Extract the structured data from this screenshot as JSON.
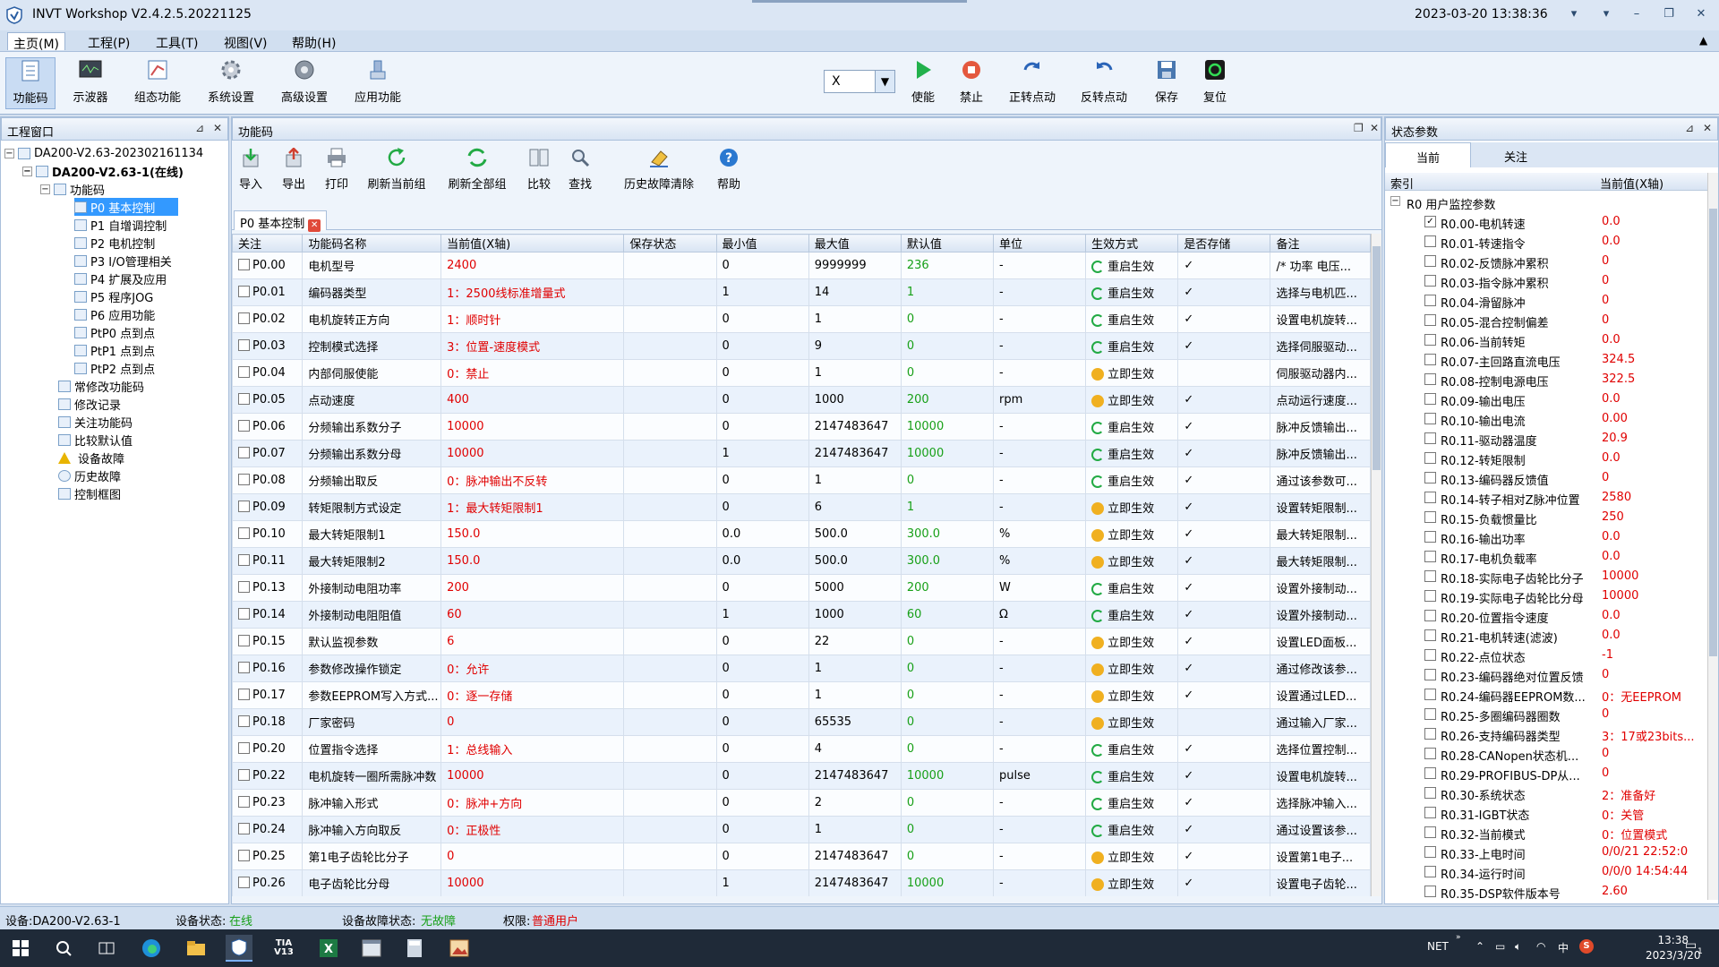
{
  "app": {
    "title": "INVT Workshop V2.4.2.5.20221125",
    "datetime": "2023-03-20 13:38:36"
  },
  "menu": [
    "主页(M)",
    "工程(P)",
    "工具(T)",
    "视图(V)",
    "帮助(H)"
  ],
  "ribbon": {
    "left": [
      "功能码",
      "示波器",
      "组态功能",
      "系统设置",
      "高级设置",
      "应用功能"
    ],
    "axis_value": "X",
    "right": [
      "使能",
      "禁止",
      "正转点动",
      "反转点动",
      "保存",
      "复位"
    ]
  },
  "left_panel": {
    "title": "工程窗口",
    "tree": [
      "DA200-V2.63-202302161134",
      "DA200-V2.63-1(在线)",
      "功能码",
      "P0 基本控制",
      "P1 自增调控制",
      "P2 电机控制",
      "P3 I/O管理相关",
      "P4 扩展及应用",
      "P5 程序JOG",
      "P6 应用功能",
      "PtP0 点到点",
      "PtP1 点到点",
      "PtP2 点到点",
      "常修改功能码",
      "修改记录",
      "关注功能码",
      "比较默认值",
      "设备故障",
      "历史故障",
      "控制框图"
    ]
  },
  "center": {
    "title": "功能码",
    "toolbar": [
      "导入",
      "导出",
      "打印",
      "刷新当前组",
      "刷新全部组",
      "比较",
      "查找",
      "历史故障清除",
      "帮助"
    ],
    "doc_tab": "P0 基本控制",
    "columns": [
      "关注",
      "功能码名称",
      "当前值(X轴)",
      "保存状态",
      "最小值",
      "最大值",
      "默认值",
      "单位",
      "生效方式",
      "是否存储",
      "备注"
    ],
    "rows": [
      [
        "P0.00",
        "电机型号",
        "2400",
        "",
        "0",
        "9999999",
        "236",
        "-",
        "重启生效",
        "✓",
        "/* 功率 电压..."
      ],
      [
        "P0.01",
        "编码器类型",
        "1：2500线标准增量式",
        "",
        "1",
        "14",
        "1",
        "-",
        "重启生效",
        "✓",
        "选择与电机匹..."
      ],
      [
        "P0.02",
        "电机旋转正方向",
        "1：顺时针",
        "",
        "0",
        "1",
        "0",
        "-",
        "重启生效",
        "✓",
        "设置电机旋转..."
      ],
      [
        "P0.03",
        "控制模式选择",
        "3：位置-速度模式",
        "",
        "0",
        "9",
        "0",
        "-",
        "重启生效",
        "✓",
        "选择伺服驱动..."
      ],
      [
        "P0.04",
        "内部伺服使能",
        "0：禁止",
        "",
        "0",
        "1",
        "0",
        "-",
        "立即生效",
        "",
        "伺服驱动器内..."
      ],
      [
        "P0.05",
        "点动速度",
        "400",
        "",
        "0",
        "1000",
        "200",
        "rpm",
        "立即生效",
        "✓",
        "点动运行速度..."
      ],
      [
        "P0.06",
        "分频输出系数分子",
        "10000",
        "",
        "0",
        "2147483647",
        "10000",
        "-",
        "重启生效",
        "✓",
        "脉冲反馈输出..."
      ],
      [
        "P0.07",
        "分频输出系数分母",
        "10000",
        "",
        "1",
        "2147483647",
        "10000",
        "-",
        "重启生效",
        "✓",
        "脉冲反馈输出..."
      ],
      [
        "P0.08",
        "分频输出取反",
        "0：脉冲输出不反转",
        "",
        "0",
        "1",
        "0",
        "-",
        "重启生效",
        "✓",
        "通过该参数可..."
      ],
      [
        "P0.09",
        "转矩限制方式设定",
        "1：最大转矩限制1",
        "",
        "0",
        "6",
        "1",
        "-",
        "立即生效",
        "✓",
        "设置转矩限制..."
      ],
      [
        "P0.10",
        "最大转矩限制1",
        "150.0",
        "",
        "0.0",
        "500.0",
        "300.0",
        "%",
        "立即生效",
        "✓",
        "最大转矩限制..."
      ],
      [
        "P0.11",
        "最大转矩限制2",
        "150.0",
        "",
        "0.0",
        "500.0",
        "300.0",
        "%",
        "立即生效",
        "✓",
        "最大转矩限制..."
      ],
      [
        "P0.13",
        "外接制动电阻功率",
        "200",
        "",
        "0",
        "5000",
        "200",
        "W",
        "重启生效",
        "✓",
        "设置外接制动..."
      ],
      [
        "P0.14",
        "外接制动电阻阻值",
        "60",
        "",
        "1",
        "1000",
        "60",
        "Ω",
        "重启生效",
        "✓",
        "设置外接制动..."
      ],
      [
        "P0.15",
        "默认监视参数",
        "6",
        "",
        "0",
        "22",
        "0",
        "-",
        "立即生效",
        "✓",
        "设置LED面板..."
      ],
      [
        "P0.16",
        "参数修改操作锁定",
        "0：允许",
        "",
        "0",
        "1",
        "0",
        "-",
        "立即生效",
        "✓",
        "通过修改该参..."
      ],
      [
        "P0.17",
        "参数EEPROM写入方式...",
        "0：逐一存储",
        "",
        "0",
        "1",
        "0",
        "-",
        "立即生效",
        "✓",
        "设置通过LED..."
      ],
      [
        "P0.18",
        "厂家密码",
        "0",
        "",
        "0",
        "65535",
        "0",
        "-",
        "立即生效",
        "",
        "通过输入厂家..."
      ],
      [
        "P0.20",
        "位置指令选择",
        "1：总线输入",
        "",
        "0",
        "4",
        "0",
        "-",
        "重启生效",
        "✓",
        "选择位置控制..."
      ],
      [
        "P0.22",
        "电机旋转一圈所需脉冲数",
        "10000",
        "",
        "0",
        "2147483647",
        "10000",
        "pulse",
        "重启生效",
        "✓",
        "设置电机旋转..."
      ],
      [
        "P0.23",
        "脉冲输入形式",
        "0：脉冲+方向",
        "",
        "0",
        "2",
        "0",
        "-",
        "重启生效",
        "✓",
        "选择脉冲输入..."
      ],
      [
        "P0.24",
        "脉冲输入方向取反",
        "0：正极性",
        "",
        "0",
        "1",
        "0",
        "-",
        "重启生效",
        "✓",
        "通过设置该参..."
      ],
      [
        "P0.25",
        "第1电子齿轮比分子",
        "0",
        "",
        "0",
        "2147483647",
        "0",
        "-",
        "立即生效",
        "✓",
        "设置第1电子..."
      ],
      [
        "P0.26",
        "电子齿轮比分母",
        "10000",
        "",
        "1",
        "2147483647",
        "10000",
        "-",
        "立即生效",
        "✓",
        "设置电子齿轮..."
      ]
    ]
  },
  "right_panel": {
    "title": "状态参数",
    "tabs": [
      "当前",
      "关注"
    ],
    "columns": [
      "索引",
      "当前值(X轴)"
    ],
    "group": "R0 用户监控参数",
    "items": [
      [
        "R0.00-电机转速",
        "0.0",
        true
      ],
      [
        "R0.01-转速指令",
        "0.0",
        false
      ],
      [
        "R0.02-反馈脉冲累积",
        "0",
        false
      ],
      [
        "R0.03-指令脉冲累积",
        "0",
        false
      ],
      [
        "R0.04-滑留脉冲",
        "0",
        false
      ],
      [
        "R0.05-混合控制偏差",
        "0",
        false
      ],
      [
        "R0.06-当前转矩",
        "0.0",
        false
      ],
      [
        "R0.07-主回路直流电压",
        "324.5",
        false
      ],
      [
        "R0.08-控制电源电压",
        "322.5",
        false
      ],
      [
        "R0.09-输出电压",
        "0.0",
        false
      ],
      [
        "R0.10-输出电流",
        "0.00",
        false
      ],
      [
        "R0.11-驱动器温度",
        "20.9",
        false
      ],
      [
        "R0.12-转矩限制",
        "0.0",
        false
      ],
      [
        "R0.13-编码器反馈值",
        "0",
        false
      ],
      [
        "R0.14-转子相对Z脉冲位置",
        "2580",
        false
      ],
      [
        "R0.15-负载惯量比",
        "250",
        false
      ],
      [
        "R0.16-输出功率",
        "0.0",
        false
      ],
      [
        "R0.17-电机负载率",
        "0.0",
        false
      ],
      [
        "R0.18-实际电子齿轮比分子",
        "10000",
        false
      ],
      [
        "R0.19-实际电子齿轮比分母",
        "10000",
        false
      ],
      [
        "R0.20-位置指令速度",
        "0.0",
        false
      ],
      [
        "R0.21-电机转速(滤波)",
        "0.0",
        false
      ],
      [
        "R0.22-点位状态",
        "-1",
        false
      ],
      [
        "R0.23-编码器绝对位置反馈",
        "0",
        false
      ],
      [
        "R0.24-编码器EEPROM数...",
        "0：无EEPROM",
        false
      ],
      [
        "R0.25-多圈编码器圈数",
        "0",
        false
      ],
      [
        "R0.26-支持编码器类型",
        "3：17或23bits...",
        false
      ],
      [
        "R0.28-CANopen状态机...",
        "0",
        false
      ],
      [
        "R0.29-PROFIBUS-DP从...",
        "0",
        false
      ],
      [
        "R0.30-系统状态",
        "2：准备好",
        false
      ],
      [
        "R0.31-IGBT状态",
        "0：关管",
        false
      ],
      [
        "R0.32-当前模式",
        "0：位置模式",
        false
      ],
      [
        "R0.33-上电时间",
        "0/0/21 22:52:0",
        false
      ],
      [
        "R0.34-运行时间",
        "0/0/0 14:54:44",
        false
      ],
      [
        "R0.35-DSP软件版本号",
        "2.60",
        false
      ]
    ]
  },
  "status": {
    "device_label": "设备:DA200-V2.63-1",
    "state_label": "设备状态:",
    "state_value": "在线",
    "fault_label": "设备故障状态:",
    "fault_value": "无故障",
    "perm_label": "权限:",
    "perm_value": "普通用户"
  },
  "taskbar": {
    "tray_net": "NET",
    "ime": "中",
    "time": "13:38",
    "date": "2023/3/20",
    "notify_count": "1"
  },
  "colors": {
    "accent": "#3399ff",
    "value_red": "#e00000",
    "default_green": "#18a018"
  }
}
